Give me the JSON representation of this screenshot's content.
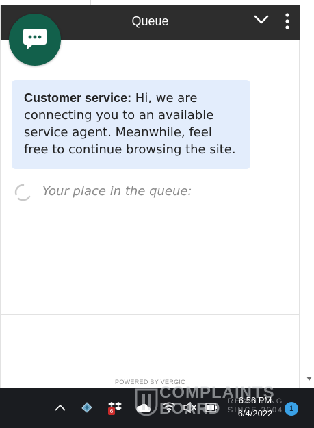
{
  "chat": {
    "title": "Queue",
    "message": {
      "sender": "Customer service:",
      "text": " Hi, we are connecting you to an available service agent. Meanwhile, feel free to continue browsing the site."
    },
    "queue_status": "Your place in the queue:",
    "footer": "POWERED BY VERGIC",
    "header_icons": [
      "chevron-down-icon",
      "more-vertical-icon"
    ],
    "colors": {
      "header": "#2d2d2d",
      "avatar": "#12604b",
      "bubble": "#e3edfc"
    }
  },
  "taskbar": {
    "time": "6:56 PM",
    "date": "6/4/2022",
    "notification_count": "1",
    "dropbox_badge": "6",
    "tray_icons": [
      "show-hidden-icons-icon",
      "app-icon",
      "dropbox-icon",
      "onedrive-icon",
      "wifi-icon",
      "volume-icon",
      "battery-icon"
    ]
  },
  "watermark": {
    "line1": "COMPLAINTS",
    "line2": "BOARD",
    "line3": "RESOLVING",
    "line4": "SINCE 2004"
  }
}
